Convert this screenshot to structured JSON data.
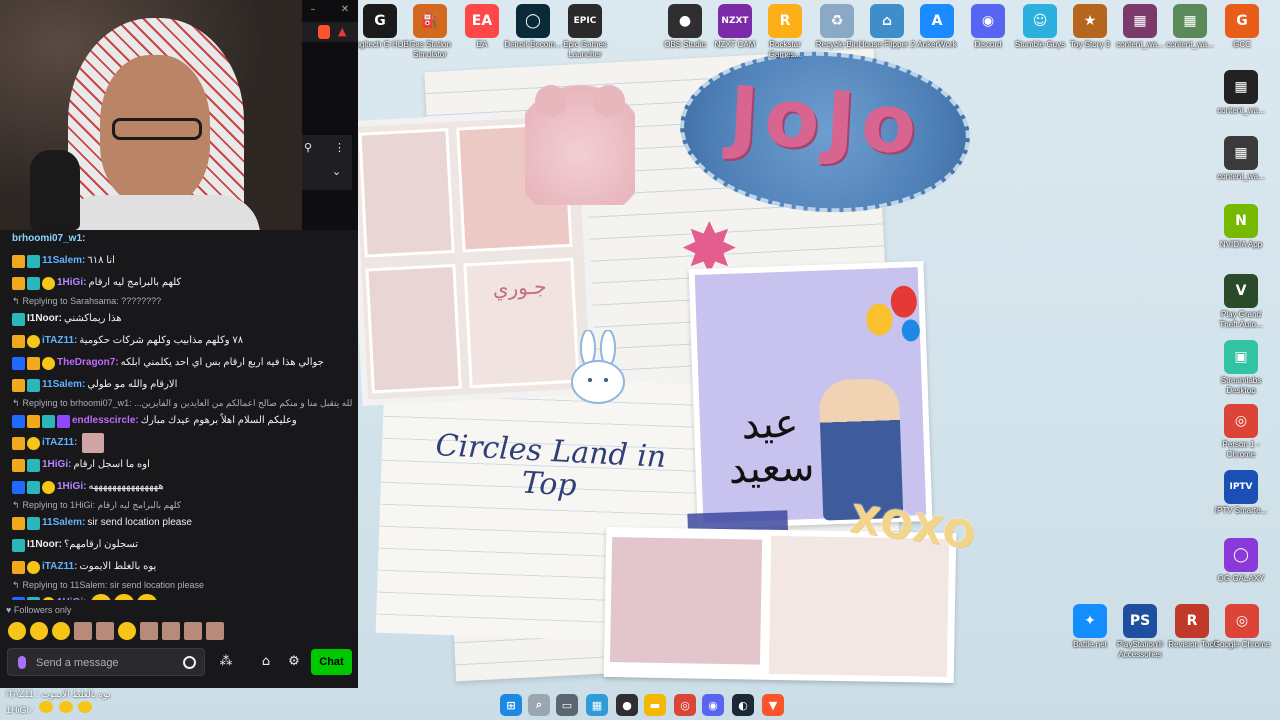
{
  "desktop": {
    "top_icons": [
      {
        "label": "Logitech G HUB",
        "glyph": "G",
        "color": "#1a1a1a",
        "icon": "logitech-ghub-icon"
      },
      {
        "label": "Gas Station Simulator",
        "glyph": "⛽",
        "color": "#d2691e",
        "icon": "gas-station-icon"
      },
      {
        "label": "EA",
        "glyph": "EA",
        "color": "#ff4747",
        "icon": "ea-icon"
      },
      {
        "label": "Detroit Becom...",
        "glyph": "◯",
        "color": "#0a2a3a",
        "icon": "detroit-icon"
      },
      {
        "label": "Epic Games Launcher",
        "glyph": "EPIC",
        "color": "#2a2a2a",
        "icon": "epic-games-icon"
      },
      {
        "label": "OBS Studio",
        "glyph": "●",
        "color": "#302e31",
        "icon": "obs-icon"
      },
      {
        "label": "NZXT CAM",
        "glyph": "NZXT",
        "color": "#7b2aa8",
        "icon": "nzxt-cam-icon"
      },
      {
        "label": "Rockstar Games...",
        "glyph": "R",
        "color": "#fcaf17",
        "icon": "rockstar-icon"
      },
      {
        "label": "Recycle Bin",
        "glyph": "♻",
        "color": "#8aa9c4",
        "icon": "recycle-bin-icon"
      },
      {
        "label": "House Flipper 2",
        "glyph": "⌂",
        "color": "#3f8ec9",
        "icon": "house-flipper-icon"
      },
      {
        "label": "AnkerWork",
        "glyph": "A",
        "color": "#1a8cff",
        "icon": "ankerwork-icon"
      },
      {
        "label": "Discord",
        "glyph": "◉",
        "color": "#5865f2",
        "icon": "discord-icon"
      },
      {
        "label": "Stumble Guys",
        "glyph": "☺",
        "color": "#2bb0e0",
        "icon": "stumble-guys-icon"
      },
      {
        "label": "Toy Story 3",
        "glyph": "★",
        "color": "#b5651d",
        "icon": "toy-story-icon"
      },
      {
        "label": "content_wa...",
        "glyph": "▦",
        "color": "#7b3a6a",
        "icon": "content-file-icon"
      },
      {
        "label": "content_wa...",
        "glyph": "▦",
        "color": "#5a8a5a",
        "icon": "content-file-icon"
      },
      {
        "label": "GCC",
        "glyph": "G",
        "color": "#e85d1a",
        "icon": "gcc-icon"
      }
    ],
    "right_icons": [
      {
        "label": "content_wa...",
        "glyph": "▦",
        "color": "#222222",
        "icon": "content-file-icon"
      },
      {
        "label": "content_wa...",
        "glyph": "▦",
        "color": "#3a3a3a",
        "icon": "content-file-icon"
      },
      {
        "label": "NVIDIA App",
        "glyph": "N",
        "color": "#76b900",
        "icon": "nvidia-icon"
      },
      {
        "label": "Play Grand Theft Auto...",
        "glyph": "V",
        "color": "#2a4a2a",
        "icon": "gta-icon"
      },
      {
        "label": "Streamlabs Desktop",
        "glyph": "▣",
        "color": "#31c3a2",
        "icon": "streamlabs-icon"
      },
      {
        "label": "Person 1 - Chrome",
        "glyph": "◎",
        "color": "#db4437",
        "icon": "chrome-icon"
      },
      {
        "label": "IPTV Smarte...",
        "glyph": "IPTV",
        "color": "#1a4fb5",
        "icon": "iptv-icon"
      },
      {
        "label": "OG GALAXY",
        "glyph": "◯",
        "color": "#8a3ad8",
        "icon": "galaxy-icon"
      }
    ],
    "bottom_icons": [
      {
        "label": "Battle.net",
        "glyph": "✦",
        "color": "#148eff",
        "icon": "battlenet-icon"
      },
      {
        "label": "PlayStation® Accessories",
        "glyph": "PS",
        "color": "#1f4fa0",
        "icon": "playstation-icon"
      },
      {
        "label": "Revision Tool",
        "glyph": "R",
        "color": "#c0392b",
        "icon": "revision-tool-icon"
      },
      {
        "label": "Google Chrome",
        "glyph": "◎",
        "color": "#db4437",
        "icon": "chrome-icon"
      }
    ],
    "wallpaper": {
      "title": "JoJo",
      "caption": "Circles Land in Top",
      "eid": "عيد سعيد",
      "name_tag": "جـوري",
      "xoxo": "XOXO"
    }
  },
  "stream_chat": {
    "messages": [
      {
        "type": "msg",
        "badges": [],
        "user": "brhoomi07_w1:",
        "color": "#8ad7ff",
        "text": "",
        "emotes": 0
      },
      {
        "type": "msg",
        "badges": [
          "crown",
          "bits"
        ],
        "user": "11Salem:",
        "color": "#5fb3ff",
        "text": "انا ٦١٨",
        "emotes": 0
      },
      {
        "type": "msg",
        "badges": [
          "crown",
          "bits",
          "sub"
        ],
        "user": "1HiGi:",
        "color": "#b787ff",
        "text": "كلهم بالبرامج ليه ارقام",
        "emotes": 0
      },
      {
        "type": "reply",
        "text": "Replying to Sarahsama: ????????"
      },
      {
        "type": "msg",
        "badges": [
          "bits"
        ],
        "user": "I1Noor:",
        "color": "#efeff1",
        "text": "هذا ريماكشني",
        "emotes": 0
      },
      {
        "type": "msg",
        "badges": [
          "crown",
          "sub"
        ],
        "user": "iTAZ11:",
        "color": "#5fb3ff",
        "text": "٧٨ وكلهم مذابيب وكلهم شركات حكومية",
        "emotes": 0
      },
      {
        "type": "msg",
        "badges": [
          "prime",
          "crown",
          "sub"
        ],
        "user": "TheDragon7:",
        "color": "#c06bff",
        "text": "جوالي هذا فيه اربع ارقام بس اي احد يكلمني ابلكه",
        "emotes": 0
      },
      {
        "type": "msg",
        "badges": [
          "crown",
          "bits"
        ],
        "user": "11Salem:",
        "color": "#5fb3ff",
        "text": "الارقام والله مو طولي",
        "emotes": 0
      },
      {
        "type": "reply",
        "text": "Replying to brhoomi07_w1: ...من عواده الله يتقبل منا و منكم صالح اعمالكم من العايدين و الفايزين"
      },
      {
        "type": "msg",
        "badges": [
          "prime",
          "crown",
          "bits",
          "gift"
        ],
        "user": "endlesscircle:",
        "color": "#c06bff",
        "text": "وعليكم السلام اهلاً برهوم عيدك مبارك",
        "emotes": 0
      },
      {
        "type": "msg",
        "badges": [
          "crown",
          "sub"
        ],
        "user": "iTAZ11:",
        "color": "#5fb3ff",
        "text": "",
        "emotes": 1
      },
      {
        "type": "msg",
        "badges": [
          "crown",
          "bits"
        ],
        "user": "1HiGi:",
        "color": "#b787ff",
        "text": "اوه ما اسجل ارقام",
        "emotes": 0
      },
      {
        "type": "msg",
        "badges": [
          "prime",
          "bits",
          "sub"
        ],
        "user": "1HiGi:",
        "color": "#b787ff",
        "text": "هههههههههههههههه",
        "emotes": 0
      },
      {
        "type": "reply",
        "text": "Replying to 1HiGi: كلهم بالبرامج ليه ارقام"
      },
      {
        "type": "msg",
        "badges": [
          "crown",
          "bits"
        ],
        "user": "11Salem:",
        "color": "#5fb3ff",
        "text": "sir send location please",
        "emotes": 0
      },
      {
        "type": "msg",
        "badges": [
          "bits"
        ],
        "user": "I1Noor:",
        "color": "#efeff1",
        "text": "تسجلون ارقامهم؟",
        "emotes": 0
      },
      {
        "type": "msg",
        "badges": [
          "crown",
          "sub"
        ],
        "user": "iTAZ11:",
        "color": "#5fb3ff",
        "text": "يوه بالغلط الايموت",
        "emotes": 0
      },
      {
        "type": "reply",
        "text": "Replying to 11Salem: sir send location please"
      },
      {
        "type": "msg",
        "badges": [
          "prime",
          "bits",
          "sub"
        ],
        "user": "1HiGi:",
        "color": "#b787ff",
        "text": "",
        "emotes": 3
      }
    ],
    "followers_only": "Followers only",
    "input_placeholder": "Send a message",
    "chat_button": "Chat",
    "overlay_lines": [
      "iTAZ11 : يوه بالغلط الايموت",
      "1HiGi :"
    ]
  },
  "taskbar": {
    "icons": [
      {
        "name": "windows-start-icon",
        "glyph": "⊞",
        "color": "#1e88e5"
      },
      {
        "name": "search-icon",
        "glyph": "⌕",
        "color": "#9aa7b0"
      },
      {
        "name": "task-view-icon",
        "glyph": "▭",
        "color": "#5a6670"
      },
      {
        "name": "widgets-icon",
        "glyph": "▦",
        "color": "#2f9bd7"
      },
      {
        "name": "obs-taskbar-icon",
        "glyph": "●",
        "color": "#302e31"
      },
      {
        "name": "file-explorer-icon",
        "glyph": "▬",
        "color": "#f5b800"
      },
      {
        "name": "chrome-taskbar-icon",
        "glyph": "◎",
        "color": "#db4437"
      },
      {
        "name": "discord-taskbar-icon",
        "glyph": "◉",
        "color": "#5865f2"
      },
      {
        "name": "steam-icon",
        "glyph": "◐",
        "color": "#1b2838"
      },
      {
        "name": "brave-icon",
        "glyph": "▼",
        "color": "#fb542b"
      }
    ]
  }
}
